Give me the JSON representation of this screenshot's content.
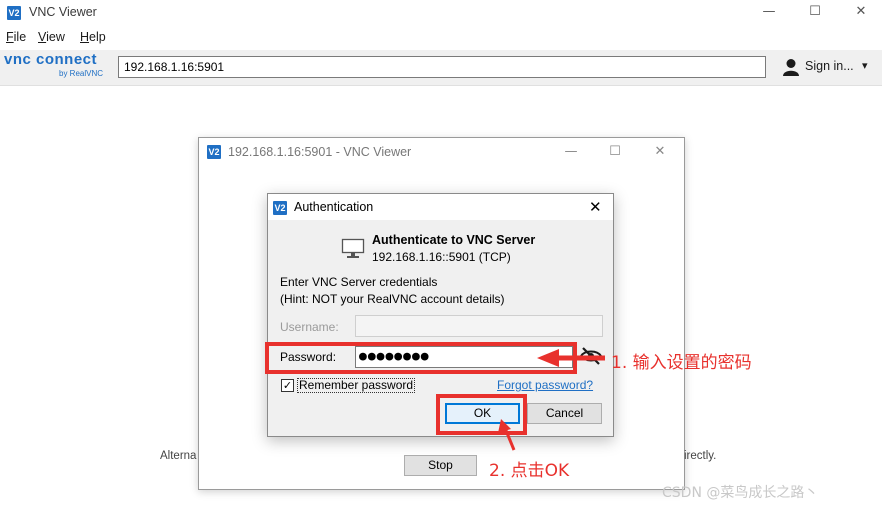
{
  "window": {
    "logo": "V2",
    "title": "VNC Viewer",
    "controls": {
      "minimize": "—",
      "maximize": "☐",
      "close": "✕"
    }
  },
  "menu": [
    "File",
    "View",
    "Help"
  ],
  "toolbar": {
    "brand_main": "vnc connect",
    "brand_sub": "by RealVNC",
    "address": "192.168.1.16:5901",
    "signin_label": "Sign in...",
    "signin_dropdown": "▾"
  },
  "child_window": {
    "logo": "V2",
    "title": "192.168.1.16:5901 - VNC Viewer",
    "controls": {
      "minimize": "—",
      "maximize": "☐",
      "close": "✕"
    },
    "alt_text_left": "Alterna",
    "alt_text_right": "irectly.",
    "stop_label": "Stop"
  },
  "auth_dialog": {
    "logo": "V2",
    "title": "Authentication",
    "close": "✕",
    "heading": "Authenticate to VNC Server",
    "server": "192.168.1.16::5901 (TCP)",
    "prompt_line1": "Enter VNC Server credentials",
    "prompt_line2": "(Hint: NOT your RealVNC account details)",
    "username_label": "Username:",
    "username_value": "",
    "password_label": "Password:",
    "password_value": "●●●●●●●●",
    "remember_label": "Remember password",
    "remember_checked": "✓",
    "forgot_label": "Forgot password?",
    "ok_label": "OK",
    "cancel_label": "Cancel"
  },
  "annotations": {
    "step1": "1. 输入设置的密码",
    "step2": "2. 点击OK",
    "color": "#e8312d"
  },
  "watermark": "CSDN @菜鸟成长之路丶",
  "colors": {
    "accent": "#1f6fc4",
    "annotation": "#e8312d",
    "focus": "#0078d7"
  },
  "icons": [
    "vnc-logo-icon",
    "monitor-icon",
    "eye-hidden-icon",
    "user-icon",
    "arrow-icon",
    "checkmark-icon"
  ]
}
